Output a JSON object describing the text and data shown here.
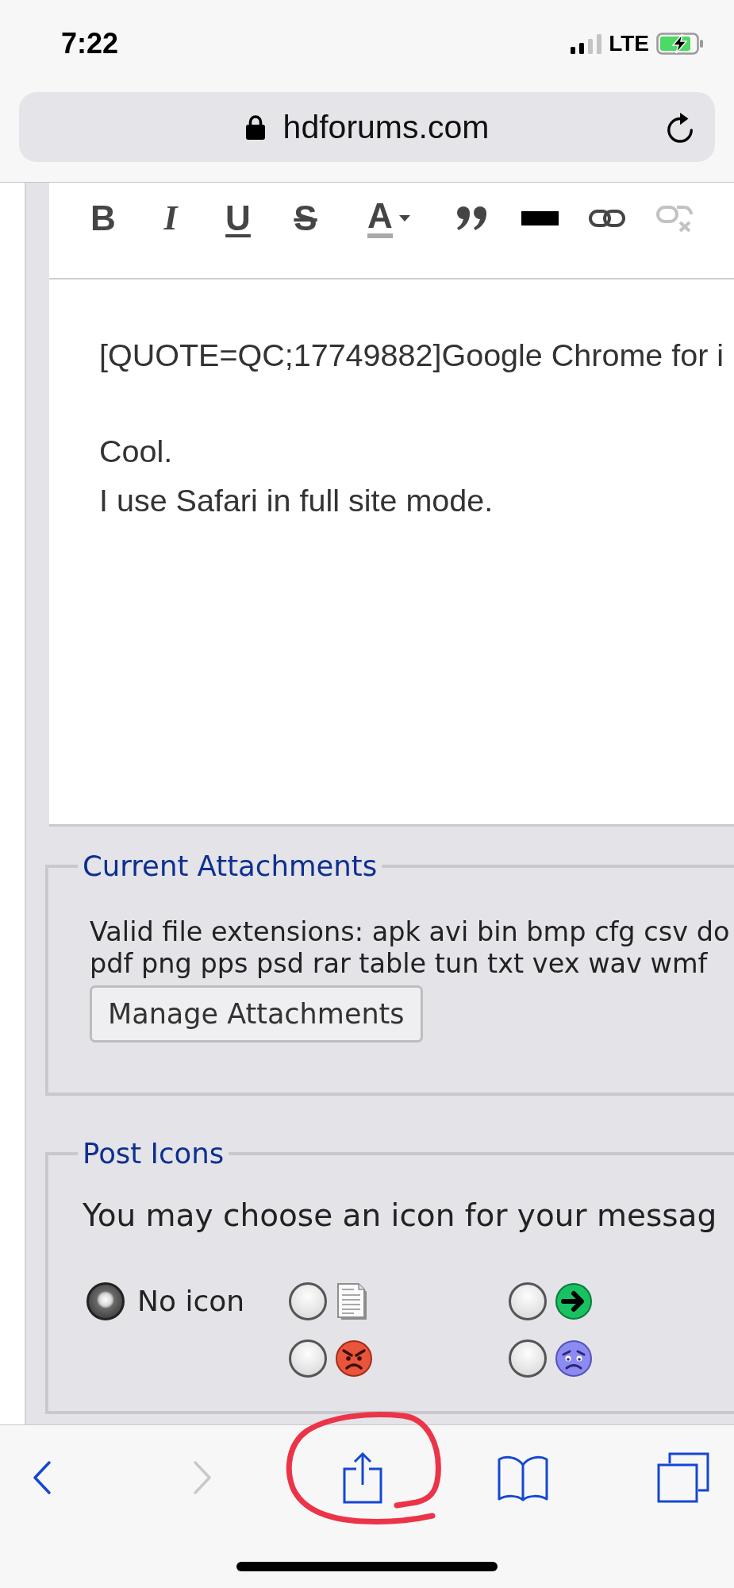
{
  "status_bar": {
    "time": "7:22",
    "network": "LTE"
  },
  "address_bar": {
    "url": "hdforums.com"
  },
  "editor": {
    "toolbar": [
      {
        "kind": "bold",
        "label": "B",
        "disabled": false
      },
      {
        "kind": "italic",
        "label": "I",
        "disabled": false
      },
      {
        "kind": "underline",
        "label": "U",
        "disabled": false
      },
      {
        "kind": "strike",
        "label": "S",
        "disabled": false
      },
      {
        "kind": "color",
        "label": "A",
        "disabled": false
      },
      {
        "kind": "quote",
        "disabled": false
      },
      {
        "kind": "bar",
        "disabled": false
      },
      {
        "kind": "link",
        "disabled": false
      },
      {
        "kind": "unlink",
        "disabled": true
      }
    ],
    "paragraphs": [
      {
        "lines": [
          "[QUOTE=QC;17749882]Google Chrome for i"
        ]
      },
      {
        "lines": [
          "Cool.",
          "I use Safari in full site mode."
        ]
      }
    ]
  },
  "attachments": {
    "legend": "Current Attachments",
    "extension_lines": [
      "Valid file extensions: apk avi bin bmp cfg csv do",
      "pdf png pps psd rar table tun txt vex wav wmf"
    ],
    "button": "Manage Attachments"
  },
  "post_icons": {
    "legend": "Post Icons",
    "prompt": "You may choose an icon for your messag",
    "options": [
      {
        "kind": "none",
        "label": "No icon",
        "selected": true
      },
      {
        "kind": "document",
        "selected": false
      },
      {
        "kind": "arrow",
        "selected": false
      },
      {
        "kind": "angry",
        "selected": false
      },
      {
        "kind": "sad",
        "selected": false
      }
    ]
  },
  "browser_toolbar": {
    "items": [
      {
        "kind": "back",
        "disabled": false,
        "circled": false
      },
      {
        "kind": "forward",
        "disabled": true,
        "circled": false
      },
      {
        "kind": "share",
        "disabled": false,
        "circled": true
      },
      {
        "kind": "bookmarks",
        "disabled": false,
        "circled": false
      },
      {
        "kind": "tabs",
        "disabled": false,
        "circled": false
      }
    ]
  }
}
